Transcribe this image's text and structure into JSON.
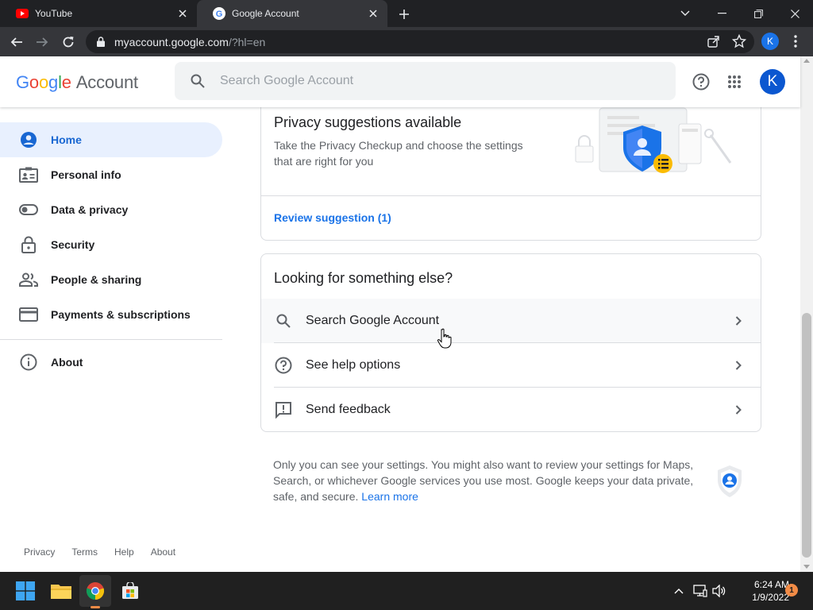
{
  "browser": {
    "tabs": [
      {
        "label": "YouTube"
      },
      {
        "label": "Google Account"
      }
    ],
    "url": {
      "host": "myaccount.google.com",
      "path": "/?hl=en"
    },
    "profile_initial": "K"
  },
  "header": {
    "logo": {
      "google_letters": [
        "G",
        "o",
        "o",
        "g",
        "l",
        "e"
      ],
      "google_colors": [
        "#4285F4",
        "#EA4335",
        "#FBBC05",
        "#4285F4",
        "#34A853",
        "#EA4335"
      ],
      "account_word": "Account"
    },
    "search_placeholder": "Search Google Account",
    "avatar_initial": "K"
  },
  "sidebar": {
    "items": [
      {
        "label": "Home",
        "icon": "account-circle-icon",
        "active": true
      },
      {
        "label": "Personal info",
        "icon": "id-card-icon"
      },
      {
        "label": "Data & privacy",
        "icon": "toggle-icon"
      },
      {
        "label": "Security",
        "icon": "lock-icon"
      },
      {
        "label": "People & sharing",
        "icon": "people-icon"
      },
      {
        "label": "Payments & subscriptions",
        "icon": "credit-card-icon"
      },
      {
        "label": "About",
        "icon": "info-icon"
      }
    ],
    "footer": [
      "Privacy",
      "Terms",
      "Help",
      "About"
    ]
  },
  "main": {
    "privacy_card": {
      "title": "Privacy suggestions available",
      "description": "Take the Privacy Checkup and choose the settings that are right for you",
      "link": "Review suggestion (1)"
    },
    "else_card": {
      "title": "Looking for something else?",
      "rows": [
        {
          "label": "Search Google Account",
          "icon": "search-icon"
        },
        {
          "label": "See help options",
          "icon": "help-icon"
        },
        {
          "label": "Send feedback",
          "icon": "feedback-icon"
        }
      ]
    },
    "info": {
      "text": "Only you can see your settings. You might also want to review your settings for Maps, Search, or whichever Google services you use most. Google keeps your data private, safe, and secure. ",
      "link": "Learn more"
    }
  },
  "taskbar": {
    "time": "6:24 AM",
    "date": "1/9/2022",
    "notification_count": "1"
  },
  "colors": {
    "accent_blue": "#1a73e8",
    "active_nav_bg": "#e8f0fe",
    "chrome_dark": "#202124",
    "taskbar": "#202020"
  }
}
